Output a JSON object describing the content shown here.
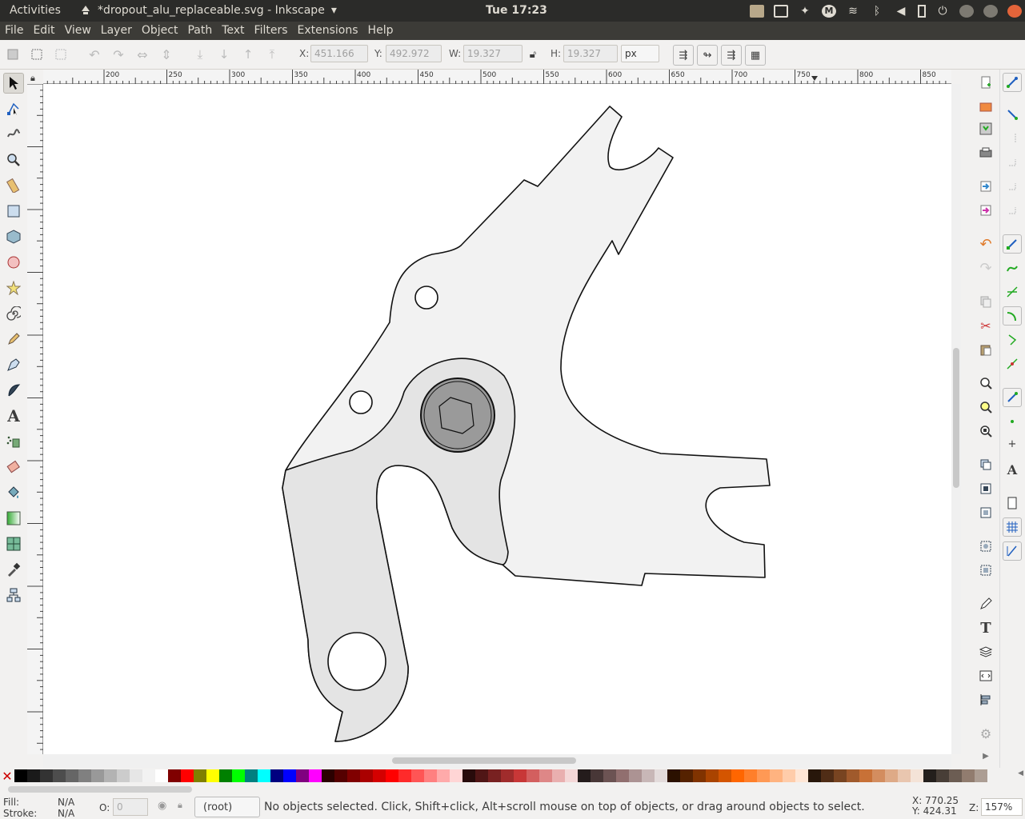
{
  "topbar": {
    "activities": "Activities",
    "app_title": "*dropout_alu_replaceable.svg - Inkscape",
    "clock": "Tue 17:23"
  },
  "menu": [
    "File",
    "Edit",
    "View",
    "Layer",
    "Object",
    "Path",
    "Text",
    "Filters",
    "Extensions",
    "Help"
  ],
  "controls": {
    "x_label": "X:",
    "x_value": "451.166",
    "y_label": "Y:",
    "y_value": "492.972",
    "w_label": "W:",
    "w_value": "19.327",
    "h_label": "H:",
    "h_value": "19.327",
    "unit": "px"
  },
  "ruler_top_labels": [
    "200",
    "250",
    "300",
    "350",
    "400",
    "450",
    "500",
    "550",
    "600",
    "650",
    "700",
    "750",
    "800",
    "850"
  ],
  "tools": [
    "selector-tool",
    "node-tool",
    "tweak-tool",
    "zoom-tool",
    "measure-tool",
    "rect-tool",
    "3dbox-tool",
    "ellipse-tool",
    "star-tool",
    "spiral-tool",
    "pencil-tool",
    "pen-tool",
    "calligraphy-tool",
    "text-tool",
    "spray-tool",
    "eraser-tool",
    "bucket-tool",
    "gradient-tool",
    "mesh-tool",
    "dropper-tool",
    "connector-tool"
  ],
  "palette": [
    "#000000",
    "#1a1a1a",
    "#333333",
    "#4d4d4d",
    "#666666",
    "#808080",
    "#999999",
    "#b3b3b3",
    "#cccccc",
    "#e6e6e6",
    "#f2f2f2",
    "#ffffff",
    "#800000",
    "#ff0000",
    "#808000",
    "#ffff00",
    "#008000",
    "#00ff00",
    "#008080",
    "#00ffff",
    "#000080",
    "#0000ff",
    "#800080",
    "#ff00ff",
    "#2b0000",
    "#550000",
    "#800000",
    "#aa0000",
    "#d40000",
    "#ff0000",
    "#ff2a2a",
    "#ff5555",
    "#ff8080",
    "#ffaaaa",
    "#ffd5d5",
    "#280b0b",
    "#501616",
    "#782121",
    "#a02c2c",
    "#c83737",
    "#d35f5f",
    "#de8787",
    "#e9afaf",
    "#f4d7d7",
    "#241c1c",
    "#483737",
    "#6c5353",
    "#916f6f",
    "#ac9393",
    "#c8b7b7",
    "#e3dbdb",
    "#2b1100",
    "#552200",
    "#803300",
    "#aa4400",
    "#d45500",
    "#ff6600",
    "#ff7f2a",
    "#ff9955",
    "#ffb380",
    "#ffccaa",
    "#ffe6d5",
    "#28170b",
    "#502d16",
    "#784421",
    "#a05a2c",
    "#c87137",
    "#d38d5f",
    "#deaa87",
    "#e9c6af",
    "#f4e3d7",
    "#241f1c",
    "#483e37",
    "#6c5d53",
    "#917c6f",
    "#ac9d93"
  ],
  "status": {
    "fill_label": "Fill:",
    "fill_value": "N/A",
    "stroke_label": "Stroke:",
    "stroke_value": "N/A",
    "opacity_label": "O:",
    "opacity_value": "0",
    "layer": "(root)",
    "message": "No objects selected. Click, Shift+click, Alt+scroll mouse on top of objects, or drag around objects to select.",
    "x_coord": "X:  770.25",
    "y_coord": "Y:  424.31",
    "zoom_label": "Z:",
    "zoom_value": "157%"
  }
}
